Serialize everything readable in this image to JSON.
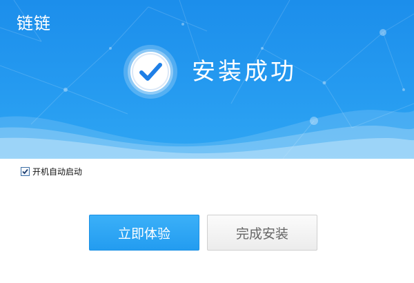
{
  "header": {
    "logo_text": "链链",
    "title": "安装成功",
    "success_icon": "check-circle-icon"
  },
  "options": {
    "autostart_label": "开机自动启动",
    "autostart_checked": true
  },
  "actions": {
    "primary_label": "立即体验",
    "secondary_label": "完成安装"
  },
  "colors": {
    "banner_blue": "#1c8eeb",
    "primary_button": "#2aa3f4",
    "wave_light": "#9fd4f6"
  }
}
